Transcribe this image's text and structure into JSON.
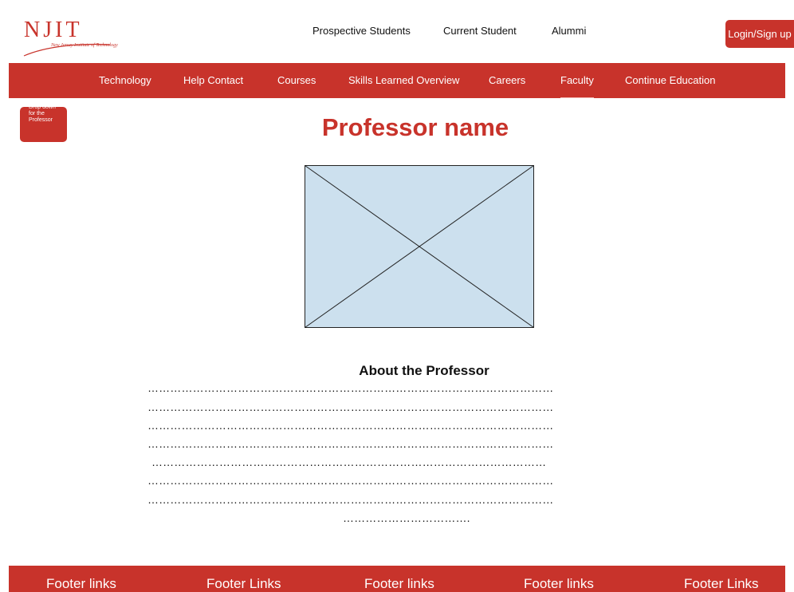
{
  "brand": {
    "logo_text": "NJIT",
    "tagline": "New Jersey Institute of Technology",
    "accent_color": "#c8332b"
  },
  "top_nav": {
    "items": [
      "Prospective Students",
      "Current Student",
      "Alummi"
    ],
    "login_label": "Login/Sign up"
  },
  "main_nav": {
    "items": [
      "Technology",
      "Help Contact",
      "Courses",
      "Skills Learned Overview",
      "Careers",
      "Faculty",
      "Continue Education"
    ],
    "active": "Faculty"
  },
  "dropdown": {
    "label": "Drop down for the Professor"
  },
  "page": {
    "title": "Professor name",
    "image_icon": "image-placeholder-icon",
    "about_heading": "About the Professor",
    "about_lines": [
      "………………………………………………………………………………………………",
      "………………………………………………………………………………………………",
      "………………………………………………………………………………………………",
      "………………………………………………………………………………………………",
      "……………………………………………………………………………………………",
      "………………………………………………………………………………………………",
      "………………………………………………………………………………………………",
      "……………………………."
    ]
  },
  "footer": {
    "links": [
      "Footer links",
      "Footer Links",
      "Footer links",
      "Footer links",
      "Footer Links"
    ]
  }
}
